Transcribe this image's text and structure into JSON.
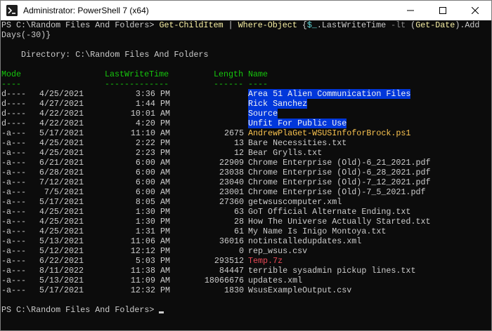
{
  "window": {
    "title": "Administrator: PowerShell 7 (x64)",
    "minimize_label": "minimize",
    "maximize_label": "maximize",
    "close_label": "close"
  },
  "console": {
    "command": {
      "prompt": "PS C:\\Random Files And Folders> ",
      "cmd1": "Get-ChildItem",
      "pipe": " | ",
      "cmd2": "Where-Object",
      "brace_open": " {",
      "var": "$_",
      "prop": ".LastWriteTime ",
      "param": "-lt",
      "paren": " (",
      "cmd3": "Get-Date",
      "tail1": ").Add",
      "tail2": "Days(-30)}"
    },
    "directory_line": "    Directory: C:\\Random Files And Folders",
    "headers": {
      "mode": "Mode",
      "lastwrite": "LastWriteTime",
      "length": "Length",
      "name": "Name"
    },
    "underlines": {
      "mode": "----",
      "lastwrite": "-------------",
      "length": "------",
      "name": "----"
    },
    "rows": [
      {
        "mode": "d----",
        "date": "4/25/2021",
        "time": "3:36 PM",
        "length": "",
        "name": "Area 51 Alien Communication Files",
        "kind": "dir"
      },
      {
        "mode": "d----",
        "date": "4/27/2021",
        "time": "1:44 PM",
        "length": "",
        "name": "Rick Sanchez",
        "kind": "dir"
      },
      {
        "mode": "d----",
        "date": "4/22/2021",
        "time": "10:01 AM",
        "length": "",
        "name": "Source",
        "kind": "dir"
      },
      {
        "mode": "d----",
        "date": "4/22/2021",
        "time": "4:20 PM",
        "length": "",
        "name": "Unfit For Public Use",
        "kind": "dir"
      },
      {
        "mode": "-a---",
        "date": "5/17/2021",
        "time": "11:10 AM",
        "length": "2675",
        "name": "AndrewPlaGet-WSUSInfoforBrock.ps1",
        "kind": "script"
      },
      {
        "mode": "-a---",
        "date": "4/25/2021",
        "time": "2:22 PM",
        "length": "13",
        "name": "Bare Necessities.txt",
        "kind": "file"
      },
      {
        "mode": "-a---",
        "date": "4/25/2021",
        "time": "2:23 PM",
        "length": "12",
        "name": "Bear Grylls.txt",
        "kind": "file"
      },
      {
        "mode": "-a---",
        "date": "6/21/2021",
        "time": "6:00 AM",
        "length": "22909",
        "name": "Chrome Enterprise (Old)-6_21_2021.pdf",
        "kind": "file"
      },
      {
        "mode": "-a---",
        "date": "6/28/2021",
        "time": "6:00 AM",
        "length": "23038",
        "name": "Chrome Enterprise (Old)-6_28_2021.pdf",
        "kind": "file"
      },
      {
        "mode": "-a---",
        "date": "7/12/2021",
        "time": "6:00 AM",
        "length": "23040",
        "name": "Chrome Enterprise (Old)-7_12_2021.pdf",
        "kind": "file"
      },
      {
        "mode": "-a---",
        "date": "7/5/2021",
        "time": "6:00 AM",
        "length": "23001",
        "name": "Chrome Enterprise (Old)-7_5_2021.pdf",
        "kind": "file"
      },
      {
        "mode": "-a---",
        "date": "5/17/2021",
        "time": "8:05 AM",
        "length": "27360",
        "name": "getwsuscomputer.xml",
        "kind": "file"
      },
      {
        "mode": "-a---",
        "date": "4/25/2021",
        "time": "1:30 PM",
        "length": "63",
        "name": "GoT Official Alternate Ending.txt",
        "kind": "file"
      },
      {
        "mode": "-a---",
        "date": "4/25/2021",
        "time": "1:30 PM",
        "length": "28",
        "name": "How The Universe Actually Started.txt",
        "kind": "file"
      },
      {
        "mode": "-a---",
        "date": "4/25/2021",
        "time": "1:31 PM",
        "length": "61",
        "name": "My Name Is Inigo Montoya.txt",
        "kind": "file"
      },
      {
        "mode": "-a---",
        "date": "5/13/2021",
        "time": "11:06 AM",
        "length": "36016",
        "name": "notinstalledupdates.xml",
        "kind": "file"
      },
      {
        "mode": "-a---",
        "date": "5/12/2021",
        "time": "12:12 PM",
        "length": "0",
        "name": "rep_wsus.csv",
        "kind": "file"
      },
      {
        "mode": "-a---",
        "date": "6/22/2021",
        "time": "5:03 PM",
        "length": "293512",
        "name": "Temp.7z",
        "kind": "archive"
      },
      {
        "mode": "-a---",
        "date": "8/11/2022",
        "time": "11:38 AM",
        "length": "84447",
        "name": "terrible sysadmin pickup lines.txt",
        "kind": "file"
      },
      {
        "mode": "-a---",
        "date": "5/13/2021",
        "time": "11:09 AM",
        "length": "18066676",
        "name": "updates.xml",
        "kind": "file"
      },
      {
        "mode": "-a---",
        "date": "5/17/2021",
        "time": "12:32 PM",
        "length": "1830",
        "name": "WsusExampleOutput.csv",
        "kind": "file"
      }
    ],
    "final_prompt": "PS C:\\Random Files And Folders> "
  },
  "colors": {
    "console_bg": "#0c0c0c",
    "text": "#cccccc",
    "header_green": "#16c60c",
    "dir_highlight": "#0037da",
    "script_yellow": "#f9c350",
    "archive_red": "#e74856"
  }
}
